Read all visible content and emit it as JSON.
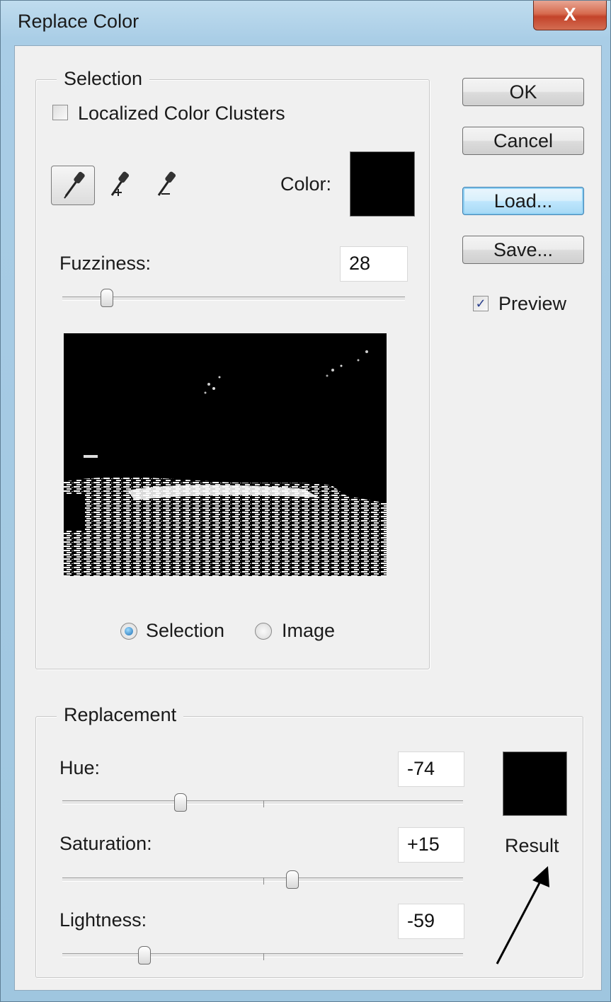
{
  "window": {
    "title": "Replace Color",
    "close_glyph": "X"
  },
  "selection": {
    "legend": "Selection",
    "localized_clusters": {
      "label": "Localized Color Clusters",
      "checked": false
    },
    "tools": [
      "eyedropper-icon",
      "eyedropper-plus-icon",
      "eyedropper-minus-icon"
    ],
    "color_label": "Color:",
    "color_value": "#000000",
    "fuzziness": {
      "label": "Fuzziness:",
      "value": "28",
      "level": 0.13
    },
    "view_options": [
      {
        "label": "Selection",
        "selected": true
      },
      {
        "label": "Image",
        "selected": false
      }
    ]
  },
  "buttons": {
    "ok": "OK",
    "cancel": "Cancel",
    "load": "Load...",
    "save": "Save..."
  },
  "preview_option": {
    "label": "Preview",
    "checked": true
  },
  "replacement": {
    "legend": "Replacement",
    "hue": {
      "label": "Hue:",
      "value": "-74",
      "level": -74
    },
    "saturation": {
      "label": "Saturation:",
      "value": "+15",
      "level": 15
    },
    "lightness": {
      "label": "Lightness:",
      "value": "-59",
      "level": -59
    },
    "result_label": "Result",
    "result_color": "#000000"
  }
}
